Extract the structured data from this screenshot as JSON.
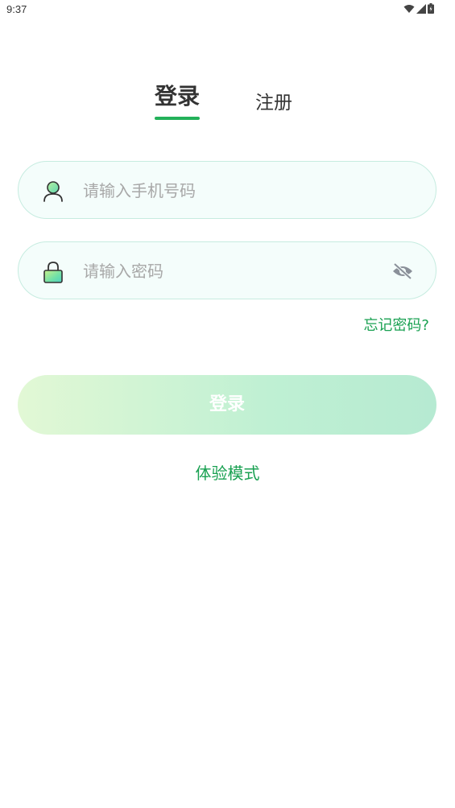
{
  "status_bar": {
    "time": "9:37",
    "icons": [
      "wifi-icon",
      "signal-icon",
      "battery-icon"
    ]
  },
  "tabs": {
    "login": "登录",
    "register": "注册",
    "active": "login"
  },
  "phone_field": {
    "placeholder": "请输入手机号码",
    "icon": "user-icon"
  },
  "password_field": {
    "placeholder": "请输入密码",
    "icon": "lock-icon",
    "toggle_icon": "eye-off-icon"
  },
  "forgot_password": "忘记密码?",
  "login_button": "登录",
  "trial_mode": "体验模式",
  "colors": {
    "accent": "#23b15a",
    "link": "#1aa152",
    "field_border": "#c6ece0",
    "field_bg": "#f4fdfb",
    "button_gradient_start": "#e2f8d5",
    "button_gradient_end": "#b6ead2"
  }
}
